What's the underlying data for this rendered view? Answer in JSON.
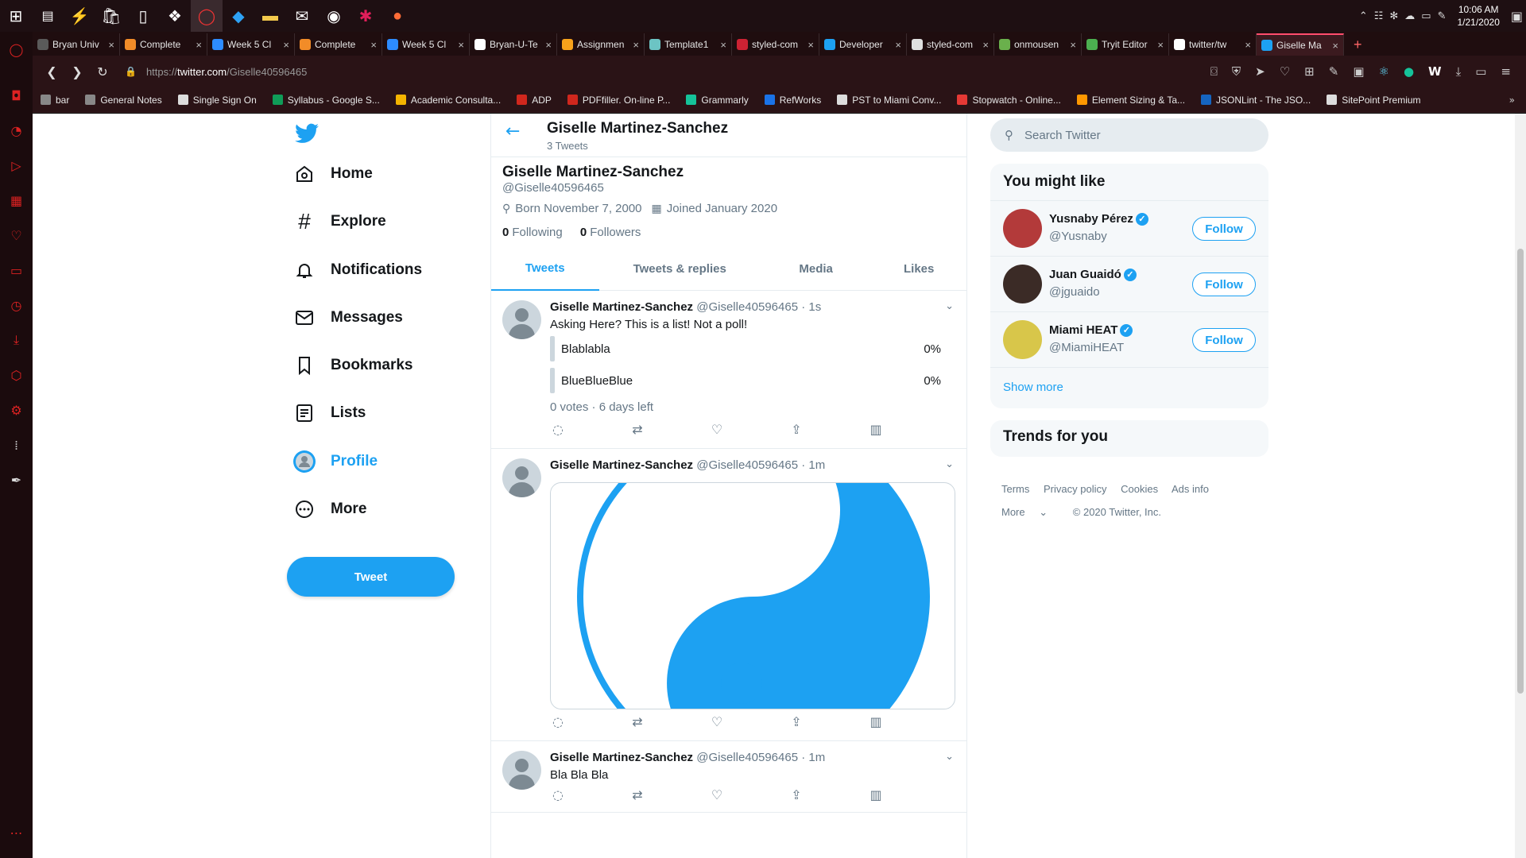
{
  "taskbar": {
    "clock_time": "10:06 AM",
    "clock_date": "1/21/2020"
  },
  "browser": {
    "tabs": [
      {
        "label": "Bryan Univ",
        "color": "#5a5a5a"
      },
      {
        "label": "Complete",
        "color": "#f28c28"
      },
      {
        "label": "Week 5 Cl",
        "color": "#2d8cff"
      },
      {
        "label": "Complete",
        "color": "#f28c28"
      },
      {
        "label": "Week 5 Cl",
        "color": "#2d8cff"
      },
      {
        "label": "Bryan-U-Te",
        "color": "#ffffff"
      },
      {
        "label": "Assignmen",
        "color": "#f7a21b"
      },
      {
        "label": "Template1",
        "color": "#6cc4c4"
      },
      {
        "label": "styled-com",
        "color": "#cc2233"
      },
      {
        "label": "Developer",
        "color": "#1da1f2"
      },
      {
        "label": "styled-com",
        "color": "#e0e0e0"
      },
      {
        "label": "onmousen",
        "color": "#6ab04c"
      },
      {
        "label": "Tryit Editor",
        "color": "#4caf50"
      },
      {
        "label": "twitter/tw",
        "color": "#ffffff"
      },
      {
        "label": "Giselle Ma",
        "color": "#1da1f2",
        "active": true
      }
    ],
    "url_prefix": "https://",
    "url_host": "twitter.com",
    "url_path": "/Giselle40596465",
    "bookmarks": [
      {
        "label": "bar",
        "color": "#888888"
      },
      {
        "label": "General Notes",
        "color": "#888888"
      },
      {
        "label": "Single Sign On",
        "color": "#dddddd"
      },
      {
        "label": "Syllabus - Google S...",
        "color": "#0f9d58"
      },
      {
        "label": "Academic Consulta...",
        "color": "#f4b400"
      },
      {
        "label": "ADP",
        "color": "#d0271d"
      },
      {
        "label": "PDFfiller. On-line P...",
        "color": "#d0271d"
      },
      {
        "label": "Grammarly",
        "color": "#15c39a"
      },
      {
        "label": "RefWorks",
        "color": "#1a73e8"
      },
      {
        "label": "PST to Miami Conv...",
        "color": "#dddddd"
      },
      {
        "label": "Stopwatch - Online...",
        "color": "#e53935"
      },
      {
        "label": "Element Sizing & Ta...",
        "color": "#ff9800"
      },
      {
        "label": "JSONLint - The JSO...",
        "color": "#1565c0"
      },
      {
        "label": "SitePoint Premium",
        "color": "#dddddd"
      }
    ]
  },
  "nav": {
    "items": [
      "Home",
      "Explore",
      "Notifications",
      "Messages",
      "Bookmarks",
      "Lists",
      "Profile",
      "More"
    ],
    "tweet_button": "Tweet"
  },
  "header": {
    "name": "Giselle Martinez-Sanchez",
    "tweet_count": "3 Tweets"
  },
  "profile": {
    "name": "Giselle Martinez-Sanchez",
    "handle": "@Giselle40596465",
    "born": "Born November 7, 2000",
    "joined": "Joined January 2020",
    "following_count": "0",
    "following_label": "Following",
    "followers_count": "0",
    "followers_label": "Followers"
  },
  "profile_tabs": [
    "Tweets",
    "Tweets & replies",
    "Media",
    "Likes"
  ],
  "tweets": [
    {
      "name": "Giselle Martinez-Sanchez",
      "handle": "@Giselle40596465",
      "time": "1s",
      "text": "Asking Here? This is a list! Not a poll!",
      "poll": [
        {
          "label": "Blablabla",
          "percent": "0%"
        },
        {
          "label": "BlueBlueBlue",
          "percent": "0%"
        }
      ],
      "poll_footer": "0 votes · 6 days left"
    },
    {
      "name": "Giselle Martinez-Sanchez",
      "handle": "@Giselle40596465",
      "time": "1m",
      "media": "yin-yang-image"
    },
    {
      "name": "Giselle Martinez-Sanchez",
      "handle": "@Giselle40596465",
      "time": "1m",
      "text": "Bla Bla Bla"
    }
  ],
  "sidebar": {
    "search_placeholder": "Search Twitter",
    "you_might_like_title": "You might like",
    "suggestions": [
      {
        "name": "Yusnaby Pérez",
        "handle": "@Yusnaby",
        "follow": "Follow",
        "avatar_color": "#b33a3a"
      },
      {
        "name": "Juan Guaidó",
        "handle": "@jguaido",
        "follow": "Follow",
        "avatar_color": "#3b2b26"
      },
      {
        "name": "Miami HEAT",
        "handle": "@MiamiHEAT",
        "follow": "Follow",
        "avatar_color": "#d8c64a"
      }
    ],
    "show_more": "Show more",
    "trends_title": "Trends for you",
    "footer_links": [
      "Terms",
      "Privacy policy",
      "Cookies",
      "Ads info"
    ],
    "footer_more": "More",
    "copyright": "© 2020 Twitter, Inc."
  },
  "colors": {
    "accent": "#1da1f2",
    "text": "#14171a",
    "muted": "#657786"
  }
}
